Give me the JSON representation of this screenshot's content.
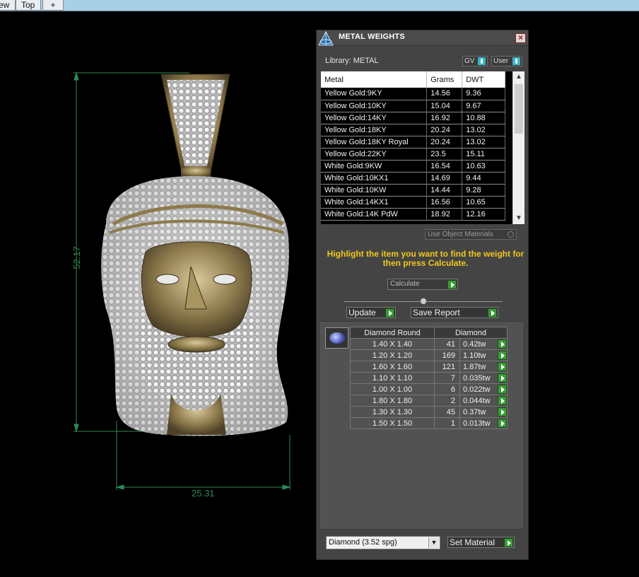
{
  "tabs": [
    {
      "label": "ew"
    },
    {
      "label": "Top"
    },
    {
      "label": "+"
    }
  ],
  "viewport": {
    "dimension_height": "52.17",
    "dimension_width": "25.31"
  },
  "panel": {
    "title": "METAL WEIGHTS",
    "close_glyph": "×",
    "library_label": "Library: METAL",
    "toggle_gv": "GV",
    "toggle_user": "User",
    "metal_headers": [
      "Metal",
      "Grams",
      "DWT"
    ],
    "metals": [
      {
        "name": "Yellow Gold:9KY",
        "grams": "14.56",
        "dwt": "9.36"
      },
      {
        "name": "Yellow Gold:10KY",
        "grams": "15.04",
        "dwt": "9.67"
      },
      {
        "name": "Yellow Gold:14KY",
        "grams": "16.92",
        "dwt": "10.88"
      },
      {
        "name": "Yellow Gold:18KY",
        "grams": "20.24",
        "dwt": "13.02"
      },
      {
        "name": "Yellow Gold:18KY Royal",
        "grams": "20.24",
        "dwt": "13.02"
      },
      {
        "name": "Yellow Gold:22KY",
        "grams": "23.5",
        "dwt": "15.11"
      },
      {
        "name": "White Gold:9KW",
        "grams": "16.54",
        "dwt": "10.63"
      },
      {
        "name": "White Gold:10KX1",
        "grams": "14.69",
        "dwt": "9.44"
      },
      {
        "name": "White Gold:10KW",
        "grams": "14.44",
        "dwt": "9.28"
      },
      {
        "name": "White Gold:14KX1",
        "grams": "16.56",
        "dwt": "10.65"
      },
      {
        "name": "White Gold:14K PdW",
        "grams": "18.92",
        "dwt": "12.16"
      }
    ],
    "use_object_materials": "Use Object Materials",
    "hint": "Highlight the item you want to find the weight for then press Calculate.",
    "calculate_label": "Calculate",
    "update_label": "Update",
    "save_report_label": "Save Report",
    "diamond_headers": [
      "Diamond Round",
      "Diamond"
    ],
    "diamonds": [
      {
        "size": "1.40 X 1.40",
        "count": "41",
        "tw": "0.42tw"
      },
      {
        "size": "1.20 X 1.20",
        "count": "169",
        "tw": "1.10tw"
      },
      {
        "size": "1.60 X 1.60",
        "count": "121",
        "tw": "1.87tw"
      },
      {
        "size": "1.10 X 1.10",
        "count": "7",
        "tw": "0.035tw"
      },
      {
        "size": "1.00 X 1.00",
        "count": "6",
        "tw": "0.022tw"
      },
      {
        "size": "1.80 X 1.80",
        "count": "2",
        "tw": "0.044tw"
      },
      {
        "size": "1.30 X 1.30",
        "count": "45",
        "tw": "0.37tw"
      },
      {
        "size": "1.50 X 1.50",
        "count": "1",
        "tw": "0.013tw"
      }
    ],
    "material_select": "Diamond     (3.52 spg)",
    "set_material_label": "Set Material"
  }
}
